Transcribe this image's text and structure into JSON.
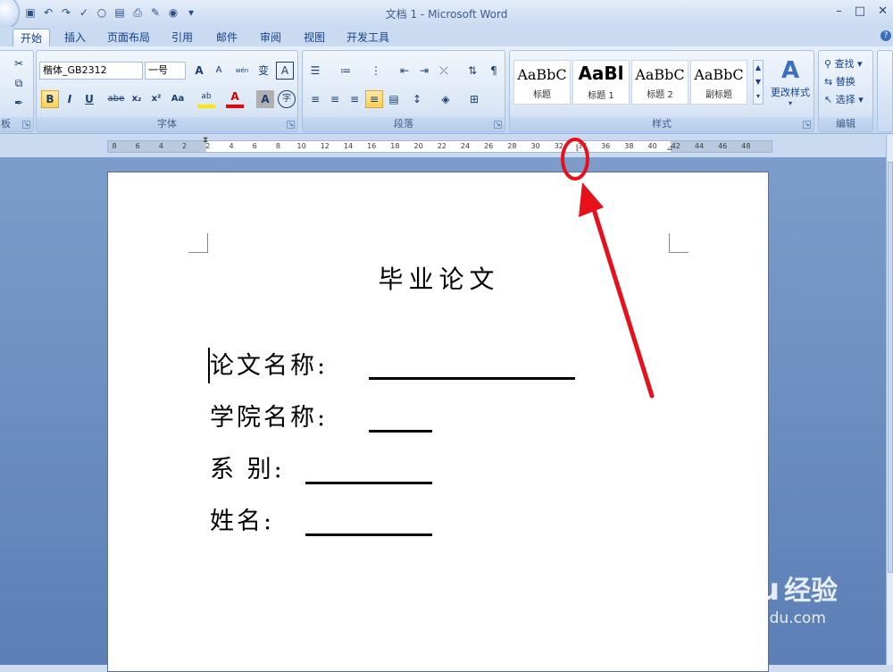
{
  "window": {
    "title": "文档 1 - Microsoft Word",
    "minimize": "–",
    "restore": "□",
    "close": "✕"
  },
  "tabs": [
    "开始",
    "插入",
    "页面布局",
    "引用",
    "邮件",
    "审阅",
    "视图",
    "开发工具"
  ],
  "clipboard": {
    "label": "板"
  },
  "font": {
    "name": "楷体_GB2312",
    "size": "一号",
    "label": "字体",
    "bold": "B",
    "italic": "I",
    "underline": "U",
    "strike": "abe",
    "subscript": "x₂",
    "superscript": "x²",
    "change_case": "Aa",
    "grow": "A",
    "shrink": "A",
    "phonetic": "wén",
    "phonetic_char": "变",
    "border_char": "A",
    "highlight": "ab",
    "color": "A",
    "shading": "A",
    "enclose": "字"
  },
  "paragraph": {
    "label": "段落"
  },
  "styles": {
    "label": "样式",
    "items": [
      {
        "sample": "AaBbC",
        "name": "标题"
      },
      {
        "sample": "AaBl",
        "name": "标题 1"
      },
      {
        "sample": "AaBbC",
        "name": "标题 2"
      },
      {
        "sample": "AaBbC",
        "name": "副标题"
      }
    ],
    "change_styles": "更改样式"
  },
  "editing": {
    "label": "编辑",
    "find": "查找",
    "replace": "替换",
    "select": "选择"
  },
  "ruler": {
    "ticks": [
      "8",
      "6",
      "4",
      "2",
      "2",
      "4",
      "6",
      "8",
      "10",
      "12",
      "14",
      "16",
      "18",
      "20",
      "22",
      "24",
      "26",
      "28",
      "30",
      "32",
      "34",
      "36",
      "38",
      "40",
      "42",
      "44",
      "46",
      "48"
    ]
  },
  "document": {
    "title": "毕业论文",
    "fields": [
      {
        "label": "论文名称:"
      },
      {
        "label": "学院名称:"
      },
      {
        "label": "系 别:"
      },
      {
        "label": "姓名:"
      }
    ]
  },
  "watermark": {
    "brand": "Baidu",
    "cn": "经验",
    "url": "jingyan.baidu.com"
  },
  "colors": {
    "annotation": "#e8111b",
    "ribbon": "#d5e3f4",
    "canvas": "#6b8ec2"
  }
}
